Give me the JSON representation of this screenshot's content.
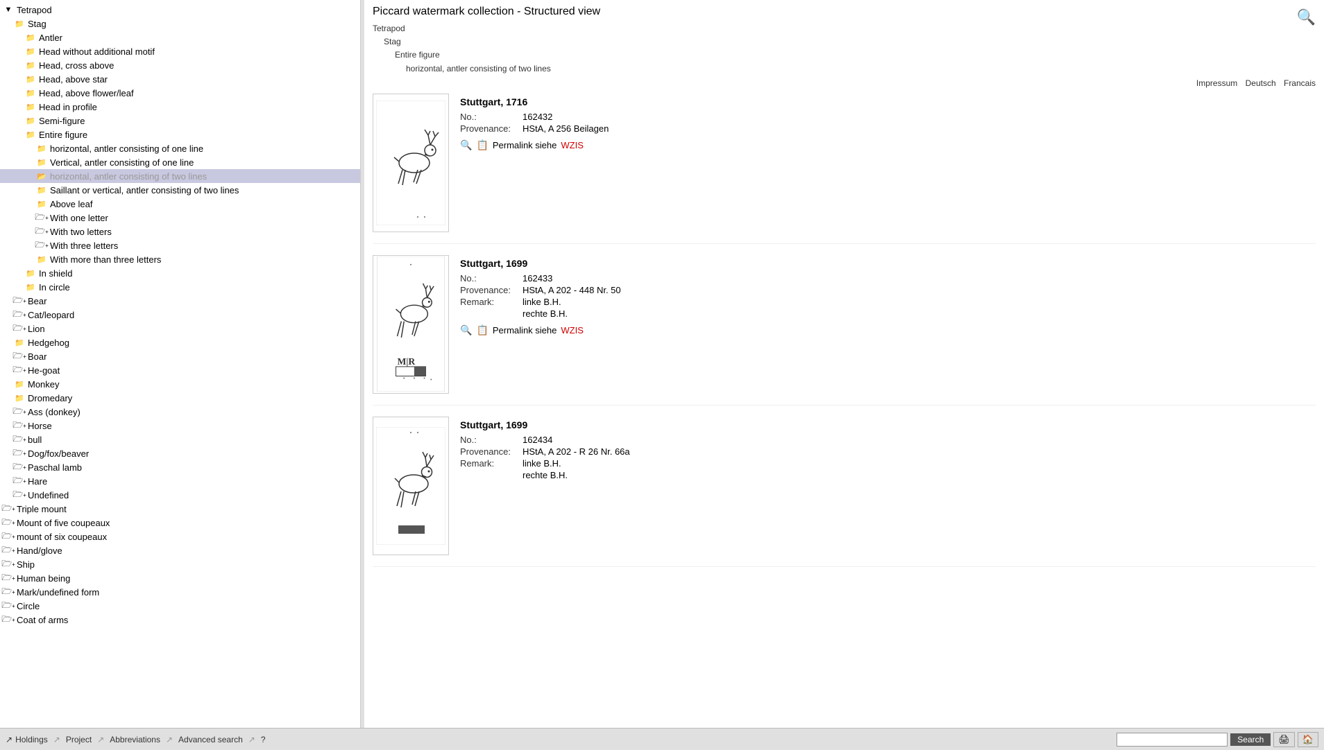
{
  "app": {
    "title": "Piccard watermark collection - Structured view"
  },
  "breadcrumb": {
    "levels": [
      {
        "text": "Tetrapod"
      },
      {
        "text": "Stag"
      },
      {
        "text": "Entire figure"
      },
      {
        "text": "horizontal, antler consisting of two lines"
      }
    ]
  },
  "top_links": {
    "impressum": "Impressum",
    "deutsch": "Deutsch",
    "francais": "Francais"
  },
  "sidebar": {
    "items": [
      {
        "id": "tetrapod",
        "label": "Tetrapod",
        "indent": 0,
        "type": "expand",
        "expanded": true
      },
      {
        "id": "stag",
        "label": "Stag",
        "indent": 1,
        "type": "folder",
        "expanded": true
      },
      {
        "id": "antler",
        "label": "Antler",
        "indent": 2,
        "type": "folder"
      },
      {
        "id": "head-without",
        "label": "Head without additional motif",
        "indent": 2,
        "type": "folder"
      },
      {
        "id": "head-cross-above",
        "label": "Head, cross above",
        "indent": 2,
        "type": "folder"
      },
      {
        "id": "head-above-star",
        "label": "Head, above star",
        "indent": 2,
        "type": "folder"
      },
      {
        "id": "head-above-flower",
        "label": "Head, above flower/leaf",
        "indent": 2,
        "type": "folder"
      },
      {
        "id": "head-in-profile",
        "label": "Head in profile",
        "indent": 2,
        "type": "folder"
      },
      {
        "id": "semi-figure",
        "label": "Semi-figure",
        "indent": 2,
        "type": "folder"
      },
      {
        "id": "entire-figure",
        "label": "Entire figure",
        "indent": 2,
        "type": "folder",
        "expanded": true
      },
      {
        "id": "horiz-one-line",
        "label": "horizontal, antler consisting of one line",
        "indent": 3,
        "type": "folder"
      },
      {
        "id": "vert-one-line",
        "label": "Vertical, antler consisting of one line",
        "indent": 3,
        "type": "folder"
      },
      {
        "id": "horiz-two-lines",
        "label": "horizontal, antler consisting of two lines",
        "indent": 3,
        "type": "folder-selected",
        "selected": true
      },
      {
        "id": "saillant",
        "label": "Saillant or vertical, antler consisting of two lines",
        "indent": 3,
        "type": "folder"
      },
      {
        "id": "above-leaf",
        "label": "Above leaf",
        "indent": 3,
        "type": "folder"
      },
      {
        "id": "with-one-letter",
        "label": "With one letter",
        "indent": 3,
        "type": "folder-plus"
      },
      {
        "id": "with-two-letters",
        "label": "With two letters",
        "indent": 3,
        "type": "folder-plus"
      },
      {
        "id": "with-three-letters",
        "label": "With three letters",
        "indent": 3,
        "type": "folder-plus"
      },
      {
        "id": "with-more-letters",
        "label": "With more than three letters",
        "indent": 3,
        "type": "folder"
      },
      {
        "id": "in-shield",
        "label": "In shield",
        "indent": 2,
        "type": "folder"
      },
      {
        "id": "in-circle",
        "label": "In circle",
        "indent": 2,
        "type": "folder"
      },
      {
        "id": "bear",
        "label": "Bear",
        "indent": 1,
        "type": "folder-plus"
      },
      {
        "id": "cat-leopard",
        "label": "Cat/leopard",
        "indent": 1,
        "type": "folder-plus"
      },
      {
        "id": "lion",
        "label": "Lion",
        "indent": 1,
        "type": "folder-plus"
      },
      {
        "id": "hedgehog",
        "label": "Hedgehog",
        "indent": 1,
        "type": "folder"
      },
      {
        "id": "boar",
        "label": "Boar",
        "indent": 1,
        "type": "folder-plus"
      },
      {
        "id": "he-goat",
        "label": "He-goat",
        "indent": 1,
        "type": "folder-plus"
      },
      {
        "id": "monkey",
        "label": "Monkey",
        "indent": 1,
        "type": "folder"
      },
      {
        "id": "dromedary",
        "label": "Dromedary",
        "indent": 1,
        "type": "folder"
      },
      {
        "id": "ass-donkey",
        "label": "Ass (donkey)",
        "indent": 1,
        "type": "folder-plus"
      },
      {
        "id": "horse",
        "label": "Horse",
        "indent": 1,
        "type": "folder-plus"
      },
      {
        "id": "bull",
        "label": "bull",
        "indent": 1,
        "type": "folder-plus"
      },
      {
        "id": "dog-fox",
        "label": "Dog/fox/beaver",
        "indent": 1,
        "type": "folder-plus"
      },
      {
        "id": "paschal-lamb",
        "label": "Paschal lamb",
        "indent": 1,
        "type": "folder-plus"
      },
      {
        "id": "hare",
        "label": "Hare",
        "indent": 1,
        "type": "folder-plus"
      },
      {
        "id": "undefined",
        "label": "Undefined",
        "indent": 1,
        "type": "folder-plus"
      },
      {
        "id": "triple-mount",
        "label": "Triple mount",
        "indent": 0,
        "type": "folder-plus"
      },
      {
        "id": "mount-five",
        "label": "Mount of five coupeaux",
        "indent": 0,
        "type": "folder-plus"
      },
      {
        "id": "mount-six",
        "label": "mount of six coupeaux",
        "indent": 0,
        "type": "folder-plus"
      },
      {
        "id": "hand-glove",
        "label": "Hand/glove",
        "indent": 0,
        "type": "folder-plus"
      },
      {
        "id": "ship",
        "label": "Ship",
        "indent": 0,
        "type": "folder-plus"
      },
      {
        "id": "human-being",
        "label": "Human being",
        "indent": 0,
        "type": "folder-plus"
      },
      {
        "id": "mark-undefined",
        "label": "Mark/undefined form",
        "indent": 0,
        "type": "folder-plus"
      },
      {
        "id": "circle",
        "label": "Circle",
        "indent": 0,
        "type": "folder-plus"
      },
      {
        "id": "coat-of-arms",
        "label": "Coat of arms",
        "indent": 0,
        "type": "folder-plus"
      }
    ]
  },
  "results": [
    {
      "id": "r1",
      "location": "Stuttgart, 1716",
      "no_label": "No.:",
      "no_value": "162432",
      "prov_label": "Provenance:",
      "prov_value": "HStA, A 256 Beilagen",
      "remark_label": "",
      "remark_value": "",
      "permalink_text": "Permalink siehe",
      "permalink_link": "WZIS"
    },
    {
      "id": "r2",
      "location": "Stuttgart, 1699",
      "no_label": "No.:",
      "no_value": "162433",
      "prov_label": "Provenance:",
      "prov_value": "HStA, A 202 - 448 Nr. 50",
      "remark_label": "Remark:",
      "remark_value": "linke B.H.",
      "remark_extra": "rechte B.H.",
      "permalink_text": "Permalink siehe",
      "permalink_link": "WZIS"
    },
    {
      "id": "r3",
      "location": "Stuttgart, 1699",
      "no_label": "No.:",
      "no_value": "162434",
      "prov_label": "Provenance:",
      "prov_value": "HStA, A 202 - R 26 Nr. 66a",
      "remark_label": "Remark:",
      "remark_value": "linke B.H.",
      "remark_extra": "rechte B.H.",
      "permalink_text": "",
      "permalink_link": ""
    }
  ],
  "bottom_bar": {
    "holdings": "Holdings",
    "project": "Project",
    "abbreviations": "Abbreviations",
    "advanced_search": "Advanced search",
    "help": "?",
    "search_placeholder": "",
    "search_button": "Search"
  },
  "icons": {
    "search": "🔍",
    "edit": "📋",
    "print": "🖨",
    "home": "🏠",
    "magnify_search": "🔎"
  }
}
